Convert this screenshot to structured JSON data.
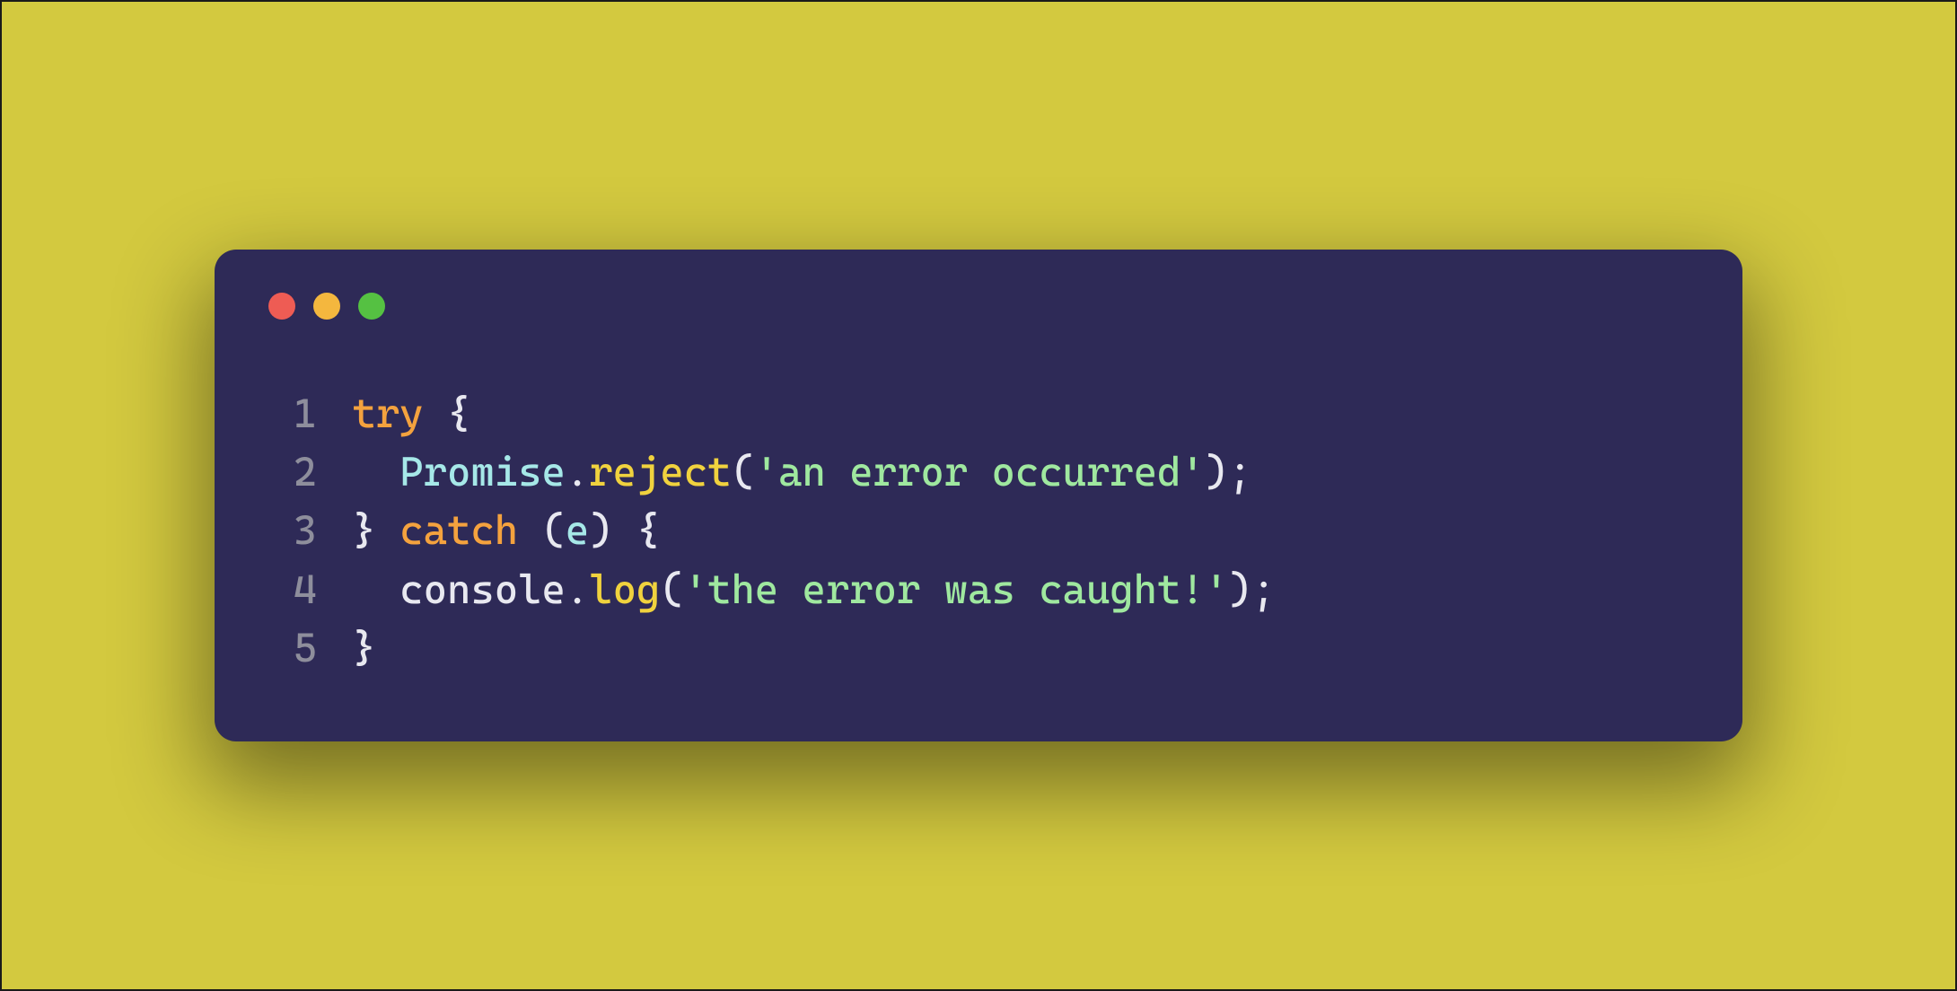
{
  "colors": {
    "page_bg": "#d3c93f",
    "window_bg": "#2e2a57",
    "line_number": "#8e8e9c",
    "keyword": "#f4a23e",
    "plain": "#e8e8f0",
    "class": "#a6e8e8",
    "method": "#f0d23e",
    "string": "#9fe89f",
    "dot_red": "#ee5c54",
    "dot_yellow": "#f4b73e",
    "dot_green": "#55c142"
  },
  "window": {
    "traffic_lights": [
      "close",
      "minimize",
      "zoom"
    ]
  },
  "code": {
    "lines": [
      {
        "n": "1",
        "tokens": [
          {
            "cls": "tok-kw",
            "t": "try"
          },
          {
            "cls": "tok-plain",
            "t": " {"
          }
        ]
      },
      {
        "n": "2",
        "tokens": [
          {
            "cls": "tok-plain",
            "t": "  "
          },
          {
            "cls": "tok-class",
            "t": "Promise"
          },
          {
            "cls": "tok-plain",
            "t": "."
          },
          {
            "cls": "tok-method",
            "t": "reject"
          },
          {
            "cls": "tok-plain",
            "t": "("
          },
          {
            "cls": "tok-str",
            "t": "'an error occurred'"
          },
          {
            "cls": "tok-plain",
            "t": ");"
          }
        ]
      },
      {
        "n": "3",
        "tokens": [
          {
            "cls": "tok-plain",
            "t": "} "
          },
          {
            "cls": "tok-kw",
            "t": "catch"
          },
          {
            "cls": "tok-plain",
            "t": " ("
          },
          {
            "cls": "tok-class",
            "t": "e"
          },
          {
            "cls": "tok-plain",
            "t": ") {"
          }
        ]
      },
      {
        "n": "4",
        "tokens": [
          {
            "cls": "tok-plain",
            "t": "  console."
          },
          {
            "cls": "tok-method",
            "t": "log"
          },
          {
            "cls": "tok-plain",
            "t": "("
          },
          {
            "cls": "tok-str",
            "t": "'the error was caught!'"
          },
          {
            "cls": "tok-plain",
            "t": ");"
          }
        ]
      },
      {
        "n": "5",
        "tokens": [
          {
            "cls": "tok-plain",
            "t": "}"
          }
        ]
      }
    ]
  }
}
